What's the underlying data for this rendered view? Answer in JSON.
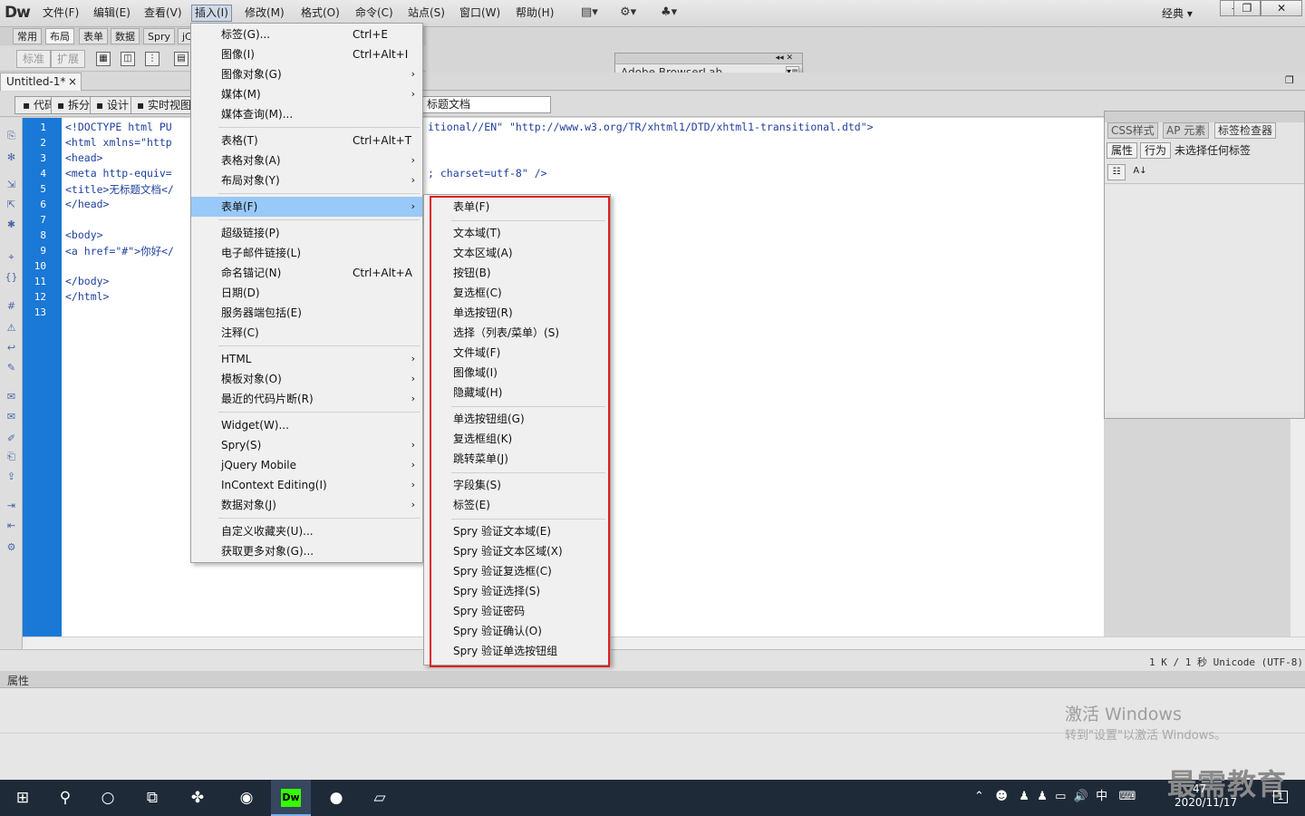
{
  "menubar": {
    "logo": "Dw",
    "items": [
      "文件(F)",
      "编辑(E)",
      "查看(V)",
      "插入(I)",
      "修改(M)",
      "格式(O)",
      "命令(C)",
      "站点(S)",
      "窗口(W)",
      "帮助(H)"
    ],
    "layout_mode": "经典",
    "win_controls": [
      "–",
      "❐",
      "✕"
    ]
  },
  "insert_panel": {
    "tabs": [
      "常用",
      "布局",
      "表单",
      "数据",
      "Spry",
      "jC"
    ],
    "buttons": [
      "标准",
      "扩展"
    ]
  },
  "browserlab": {
    "title": "Adobe BrowserLab"
  },
  "document": {
    "tab_name": "Untitled-1*",
    "close": "×",
    "view_buttons": [
      "代码",
      "拆分",
      "设计",
      "实时视图"
    ],
    "title_value": "标题文档"
  },
  "code": {
    "line_numbers": [
      "1",
      "2",
      "3",
      "4",
      "5",
      "6",
      "7",
      "8",
      "9",
      "10",
      "11",
      "12",
      "13"
    ],
    "left_lines": [
      "<!DOCTYPE html PU",
      "<html xmlns=\"http",
      "<head>",
      "<meta http-equiv=",
      "<title>无标题文档</",
      "</head>",
      "",
      "<body>",
      "<a href=\"#\">你好</",
      "",
      "</body>",
      "</html>",
      ""
    ],
    "right_line1": "itional//EN\" \"http://www.w3.org/TR/xhtml1/DTD/xhtml1-transitional.dtd\">",
    "right_line4": "; charset=utf-8\" />"
  },
  "status": {
    "text": "1 K / 1 秒 Unicode (UTF-8)"
  },
  "right_panel": {
    "tabs": [
      "CSS样式",
      "AP 元素",
      "标签检查器"
    ],
    "subtabs": [
      "属性",
      "行为"
    ],
    "label": "未选择任何标签"
  },
  "properties": {
    "title": "属性"
  },
  "watermark": {
    "line1": "激活 Windows",
    "line2": "转到\"设置\"以激活 Windows。",
    "brand": "最需教育"
  },
  "taskbar": {
    "clock_time": "47",
    "clock_date": "2020/11/17",
    "ime": "中",
    "notif": "1"
  },
  "insert_menu": {
    "items": [
      {
        "label": "标签(G)...",
        "shortcut": "Ctrl+E",
        "arrow": ""
      },
      {
        "label": "图像(I)",
        "shortcut": "Ctrl+Alt+I",
        "arrow": ""
      },
      {
        "label": "图像对象(G)",
        "shortcut": "",
        "arrow": "›"
      },
      {
        "label": "媒体(M)",
        "shortcut": "",
        "arrow": "›"
      },
      {
        "label": "媒体查询(M)...",
        "shortcut": "",
        "arrow": ""
      },
      {
        "label": "表格(T)",
        "shortcut": "Ctrl+Alt+T",
        "arrow": ""
      },
      {
        "label": "表格对象(A)",
        "shortcut": "",
        "arrow": "›"
      },
      {
        "label": "布局对象(Y)",
        "shortcut": "",
        "arrow": "›"
      },
      {
        "label": "表单(F)",
        "shortcut": "",
        "arrow": "›"
      },
      {
        "label": "超级链接(P)",
        "shortcut": "",
        "arrow": ""
      },
      {
        "label": "电子邮件链接(L)",
        "shortcut": "",
        "arrow": ""
      },
      {
        "label": "命名锚记(N)",
        "shortcut": "Ctrl+Alt+A",
        "arrow": ""
      },
      {
        "label": "日期(D)",
        "shortcut": "",
        "arrow": ""
      },
      {
        "label": "服务器端包括(E)",
        "shortcut": "",
        "arrow": ""
      },
      {
        "label": "注释(C)",
        "shortcut": "",
        "arrow": ""
      },
      {
        "label": "HTML",
        "shortcut": "",
        "arrow": "›"
      },
      {
        "label": "模板对象(O)",
        "shortcut": "",
        "arrow": "›"
      },
      {
        "label": "最近的代码片断(R)",
        "shortcut": "",
        "arrow": "›"
      },
      {
        "label": "Widget(W)...",
        "shortcut": "",
        "arrow": ""
      },
      {
        "label": "Spry(S)",
        "shortcut": "",
        "arrow": "›"
      },
      {
        "label": "jQuery Mobile",
        "shortcut": "",
        "arrow": "›"
      },
      {
        "label": "InContext Editing(I)",
        "shortcut": "",
        "arrow": "›"
      },
      {
        "label": "数据对象(J)",
        "shortcut": "",
        "arrow": "›"
      },
      {
        "label": "自定义收藏夹(U)...",
        "shortcut": "",
        "arrow": ""
      },
      {
        "label": "获取更多对象(G)...",
        "shortcut": "",
        "arrow": ""
      }
    ]
  },
  "form_menu": {
    "items": [
      "表单(F)",
      "文本域(T)",
      "文本区域(A)",
      "按钮(B)",
      "复选框(C)",
      "单选按钮(R)",
      "选择（列表/菜单）(S)",
      "文件域(F)",
      "图像域(I)",
      "隐藏域(H)",
      "单选按钮组(G)",
      "复选框组(K)",
      "跳转菜单(J)",
      "字段集(S)",
      "标签(E)",
      "Spry 验证文本域(E)",
      "Spry 验证文本区域(X)",
      "Spry 验证复选框(C)",
      "Spry 验证选择(S)",
      "Spry 验证密码",
      "Spry 验证确认(O)",
      "Spry 验证单选按钮组"
    ]
  },
  "colors": {
    "gutter": "#1a78d6",
    "highlight": "#99c9f8",
    "redbox": "#e02020"
  }
}
